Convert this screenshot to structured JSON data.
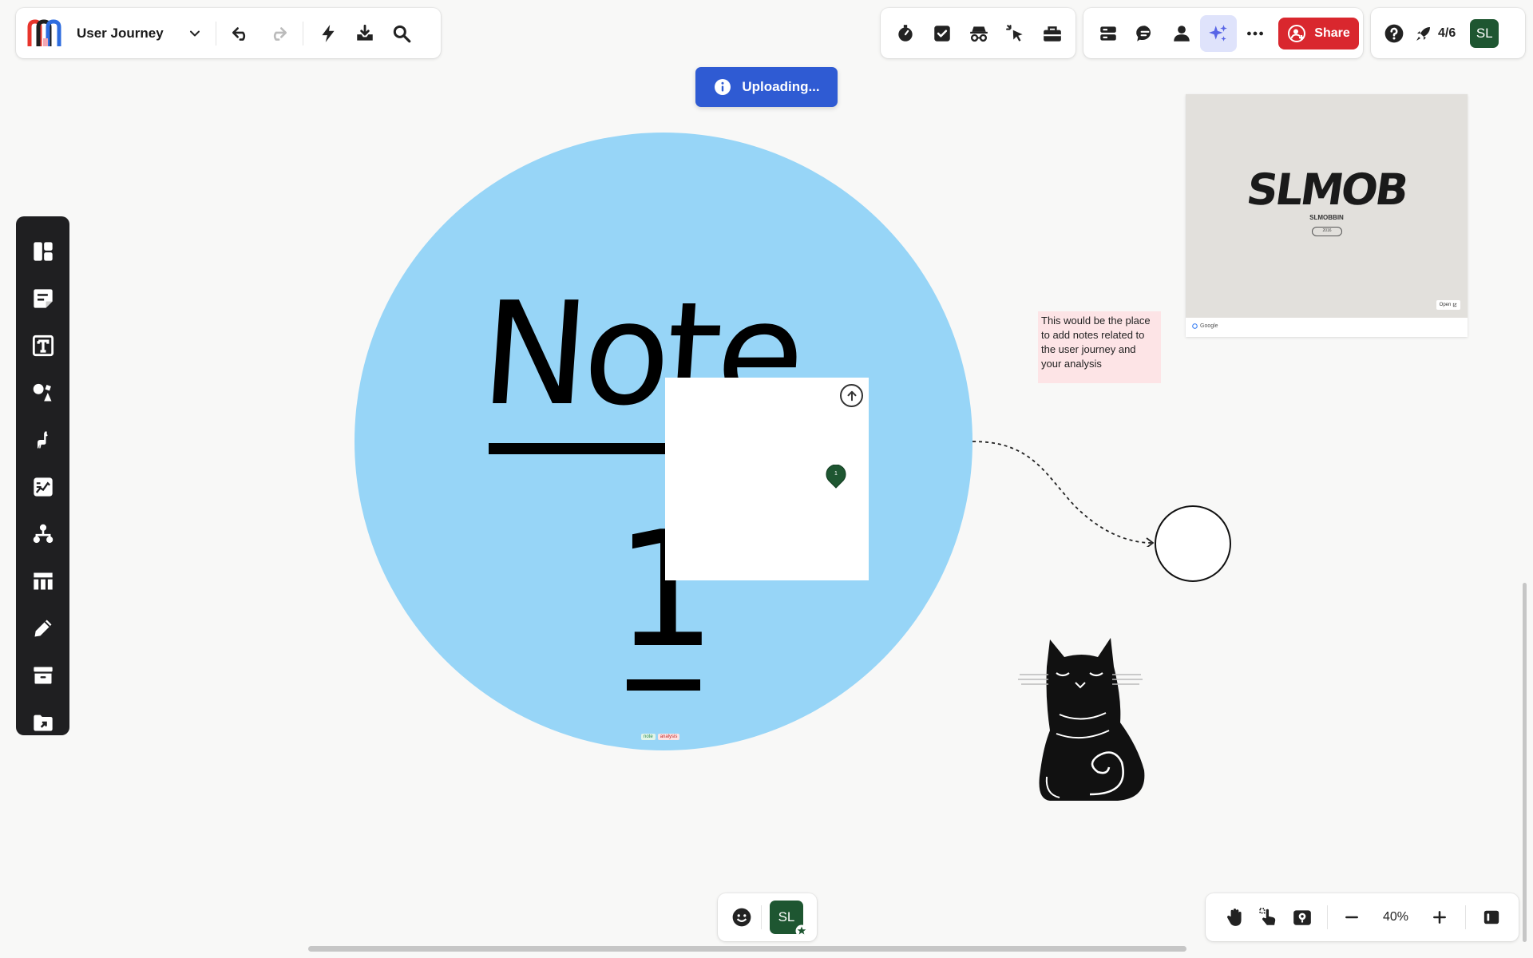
{
  "board": {
    "title": "User Journey",
    "logo_colors": [
      "#e8352c",
      "#2d6cdf",
      "#1f1f1f",
      "#f2a7b4"
    ]
  },
  "toolbar_left": {
    "icons": [
      "chevron-down-icon",
      "undo-icon",
      "redo-icon",
      "lightning-icon",
      "download-icon",
      "search-icon"
    ]
  },
  "toolbar_center": {
    "icons": [
      "timer-icon",
      "checkbox-icon",
      "incognito-icon",
      "cursor-click-icon",
      "toolbox-icon"
    ]
  },
  "toolbar_right": {
    "icons": [
      "outline-icon",
      "comment-icon",
      "user-icon",
      "ai-sparkle-icon",
      "more-icon"
    ],
    "share_label": "Share",
    "accent": "#d9272e"
  },
  "toolbar_account": {
    "onboarding_progress": "4/6",
    "user_initials": "SL",
    "avatar_color": "#1e5631"
  },
  "toast": {
    "message": "Uploading...",
    "color": "#2f5bd3"
  },
  "sidebar": {
    "items": [
      "templates-icon",
      "sticky-note-icon",
      "text-icon",
      "shapes-icon",
      "llama-icon",
      "chart-icon",
      "mindmap-icon",
      "table-icon",
      "pen-icon",
      "archive-icon",
      "upload-icon"
    ]
  },
  "canvas": {
    "circle_color": "#97d5f7",
    "handwriting_word": "Note",
    "handwriting_number": "1",
    "tags": [
      "note",
      "analysis"
    ],
    "pin_label": "1",
    "note_text": "This would be the place to add notes related to the user journey and your analysis",
    "note_color": "#fde4e6",
    "embed": {
      "logo_text": "SLMOB",
      "sub_text": "SLMOBBIN",
      "badge_text": "2016",
      "open_label": "Open",
      "source_label": "Google"
    }
  },
  "bottom_center": {
    "user_initials": "SL"
  },
  "bottom_right": {
    "zoom": "40%",
    "icons": [
      "hand-icon",
      "hand-pointer-icon",
      "map-marker-icon",
      "zoom-out-icon",
      "zoom-in-icon",
      "panel-icon"
    ]
  }
}
